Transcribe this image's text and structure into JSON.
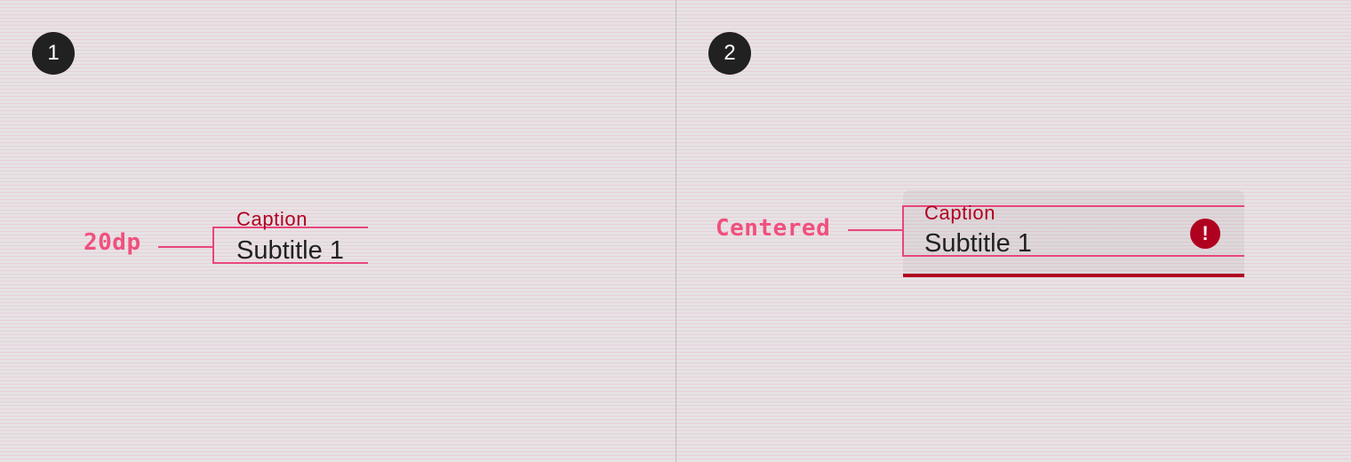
{
  "panels": [
    {
      "step": "1",
      "annotation": "20dp",
      "caption": "Caption",
      "subtitle": "Subtitle 1"
    },
    {
      "step": "2",
      "annotation": "Centered",
      "caption": "Caption",
      "subtitle": "Subtitle 1",
      "trailing_icon": "error-icon",
      "error_icon_glyph": "!"
    }
  ],
  "colors": {
    "annotation": "#f0507e",
    "caption_error": "#b00020",
    "subtitle": "#212121",
    "badge": "#212121"
  }
}
